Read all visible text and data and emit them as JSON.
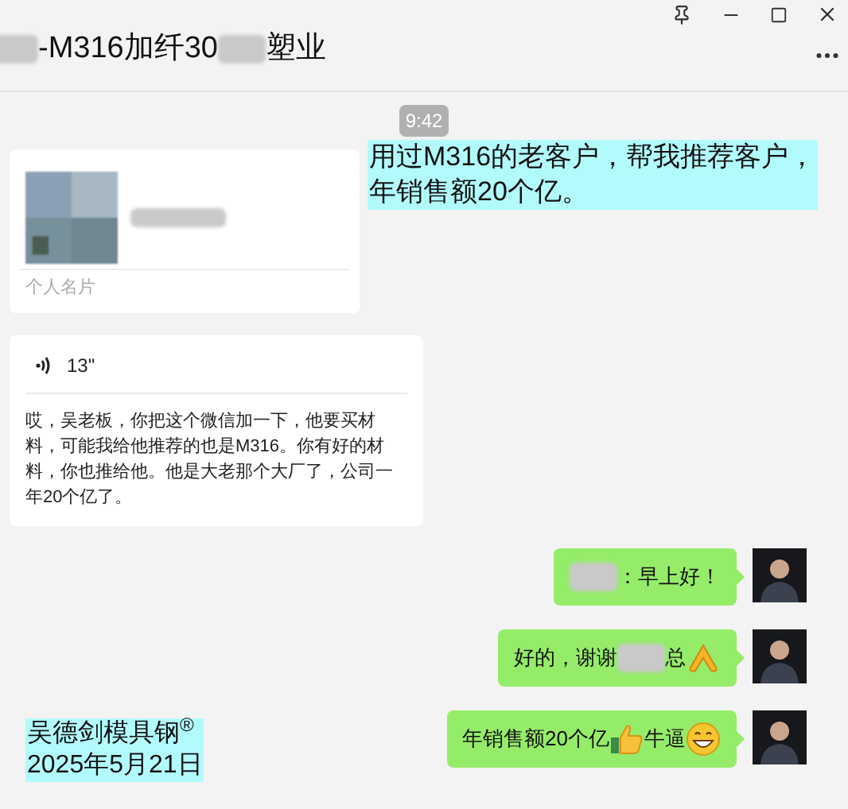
{
  "window": {
    "title_parts": [
      {
        "kind": "blur"
      },
      {
        "kind": "text",
        "text": "-M316加纤30"
      },
      {
        "kind": "blur"
      },
      {
        "kind": "text",
        "text": "塑业"
      }
    ]
  },
  "time_stamp": "9:42",
  "annotation_top": {
    "lines": [
      "用过M316的老客户，帮我推荐客户，",
      "年销售额20个亿。"
    ]
  },
  "contact_card": {
    "label": "个人名片"
  },
  "voice_message": {
    "duration": "13\"",
    "transcript": "哎，吴老板，你把这个微信加一下，他要买材料，可能我给他推荐的也是M316。你有好的材料，你也推给他。他是大老那个大厂了，公司一年20个亿了。"
  },
  "outgoing": [
    {
      "parts": [
        {
          "kind": "blur"
        },
        {
          "kind": "text",
          "text": "：早上好！"
        }
      ]
    },
    {
      "parts": [
        {
          "kind": "text",
          "text": "好的，谢谢"
        },
        {
          "kind": "blur"
        },
        {
          "kind": "text",
          "text": "总"
        },
        {
          "kind": "pray"
        }
      ]
    },
    {
      "parts": [
        {
          "kind": "text",
          "text": "年销售额20个亿"
        },
        {
          "kind": "thumbs"
        },
        {
          "kind": "text",
          "text": "牛逼"
        },
        {
          "kind": "grin"
        }
      ]
    }
  ],
  "annotation_bottom": {
    "lines": [
      "吴德剑模具钢$^{®}$",
      "2025年5月21日"
    ]
  }
}
